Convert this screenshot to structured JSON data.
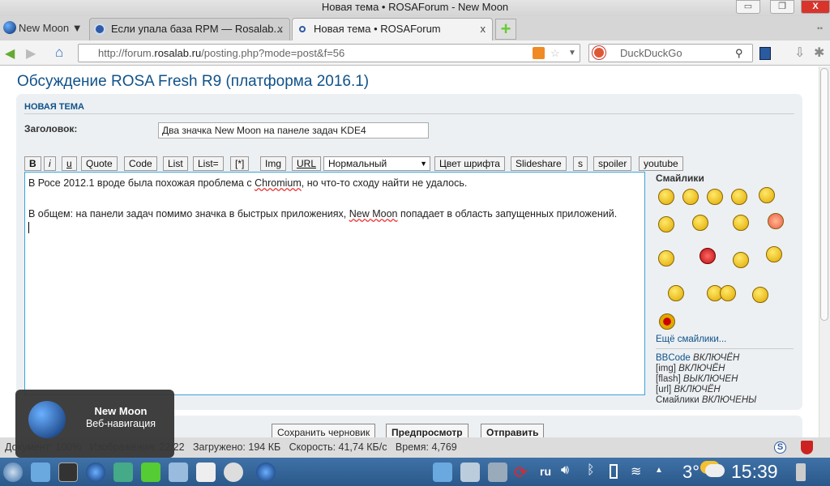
{
  "window": {
    "title": "Новая тема • ROSAForum - New Moon",
    "min": "▭",
    "max": "❐",
    "close": "X"
  },
  "tabs": {
    "app_menu": "New Moon ▼",
    "items": [
      {
        "label": "Если упала база RPM — Rosalab...",
        "close": "x"
      },
      {
        "label": "Новая тема • ROSAForum",
        "close": "x"
      }
    ],
    "new_tab": "+"
  },
  "nav": {
    "url_pre": "http://forum.",
    "url_domain": "rosalab.ru",
    "url_post": "/posting.php?mode=post&f=56",
    "search_placeholder": "DuckDuckGo"
  },
  "page": {
    "title": "Обсуждение ROSA Fresh R9 (платформа 2016.1)",
    "section": "НОВАЯ ТЕМА",
    "subject_label": "Заголовок:",
    "subject_value": "Два значка New Moon на панеле задач KDE4",
    "toolbar": [
      "B",
      "i",
      "u",
      "Quote",
      "Code",
      "List",
      "List=",
      "[*]",
      "Img",
      "URL"
    ],
    "font_size": "Нормальный",
    "toolbar2": [
      "Цвет шрифта",
      "Slideshare",
      "s",
      "spoiler",
      "youtube"
    ],
    "body": {
      "l1a": "В Росе 2012.1 вроде была похожая проблема с ",
      "l1w": "Chromium",
      "l1b": ", но что-то сходу найти не удалось.",
      "l2a": "В общем: на панели задач помимо значка в быстрых приложениях, ",
      "l2w": "New Moon",
      "l2b": " попадает в область запущенных приложений."
    },
    "smilies_title": "Смайлики",
    "more_smilies": "Ещё смайлики...",
    "opts": [
      {
        "k": "BBCode",
        "v": "ВКЛЮЧЁН"
      },
      {
        "k": "[img]",
        "v": "ВКЛЮЧЁН"
      },
      {
        "k": "[flash]",
        "v": "ВЫКЛЮЧЕН"
      },
      {
        "k": "[url]",
        "v": "ВКЛЮЧЁН"
      },
      {
        "k": "Смайлики",
        "v": "ВКЛЮЧЕНЫ"
      }
    ],
    "buttons": {
      "draft": "Сохранить черновик",
      "preview": "Предпросмотр",
      "submit": "Отправить"
    }
  },
  "status": "Документ: 100%   Изображения: 22/22   Загружено: 194 КБ   Скорость: 41,74 КБ/с   Время: 4,769",
  "notification": {
    "title": "New Moon",
    "subtitle": "Веб-навигация"
  },
  "tray": {
    "lang": "ru",
    "temp": "3°",
    "clock": "15:39"
  }
}
